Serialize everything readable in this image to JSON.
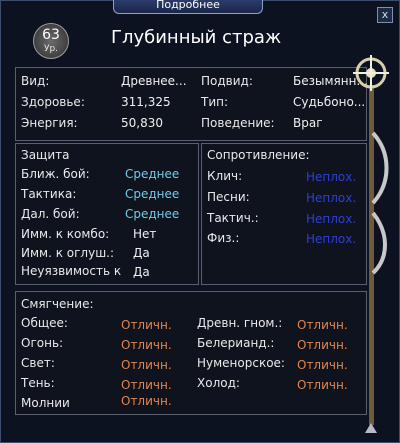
{
  "header": {
    "tab_label": "Подробнее",
    "close": "x"
  },
  "mob": {
    "level": "63",
    "level_label": "Ур.",
    "name": "Глубинный страж"
  },
  "info": [
    {
      "label": "Вид:",
      "value": "Древнее..."
    },
    {
      "label": "Здоровье:",
      "value": "311,325"
    },
    {
      "label": "Энергия:",
      "value": "50,830"
    },
    {
      "label": "Подвид:",
      "value": "Безымянн..."
    },
    {
      "label": "Тип:",
      "value": "Судьбоно..."
    },
    {
      "label": "Поведение:",
      "value": "Враг"
    }
  ],
  "defense": {
    "title": "Защита",
    "rows": [
      {
        "label": "Ближ. бой:",
        "value": "Среднее"
      },
      {
        "label": "Тактика:",
        "value": "Среднее"
      },
      {
        "label": "Дал. бой:",
        "value": "Среднее"
      },
      {
        "label": "Имм. к комбо:",
        "value": "Нет"
      },
      {
        "label": "Имм. к оглуш.:",
        "value": "Да"
      },
      {
        "label": "Неуязвимость к",
        "value": "Да"
      }
    ]
  },
  "resistance": {
    "title": "Сопротивление:",
    "rows": [
      {
        "label": "Клич:",
        "value": "Неплох."
      },
      {
        "label": "Песни:",
        "value": "Неплох."
      },
      {
        "label": "Тактич.:",
        "value": "Неплох."
      },
      {
        "label": "Физ.:",
        "value": "Неплох."
      }
    ]
  },
  "mitigation": {
    "title": "Смягчение:",
    "left": [
      {
        "label": "Общее:",
        "value": "Отличн."
      },
      {
        "label": "Огонь:",
        "value": "Отличн."
      },
      {
        "label": "Свет:",
        "value": "Отличн."
      },
      {
        "label": "Тень:",
        "value": "Отличн."
      },
      {
        "label": "Молнии",
        "value": "Отличн."
      }
    ],
    "right": [
      {
        "label": "Древн. гном.:",
        "value": "Отличн."
      },
      {
        "label": "Белерианд.:",
        "value": "Отличн."
      },
      {
        "label": "Нуменорское:",
        "value": "Отличн."
      },
      {
        "label": "Холод:",
        "value": "Отличн."
      }
    ]
  }
}
